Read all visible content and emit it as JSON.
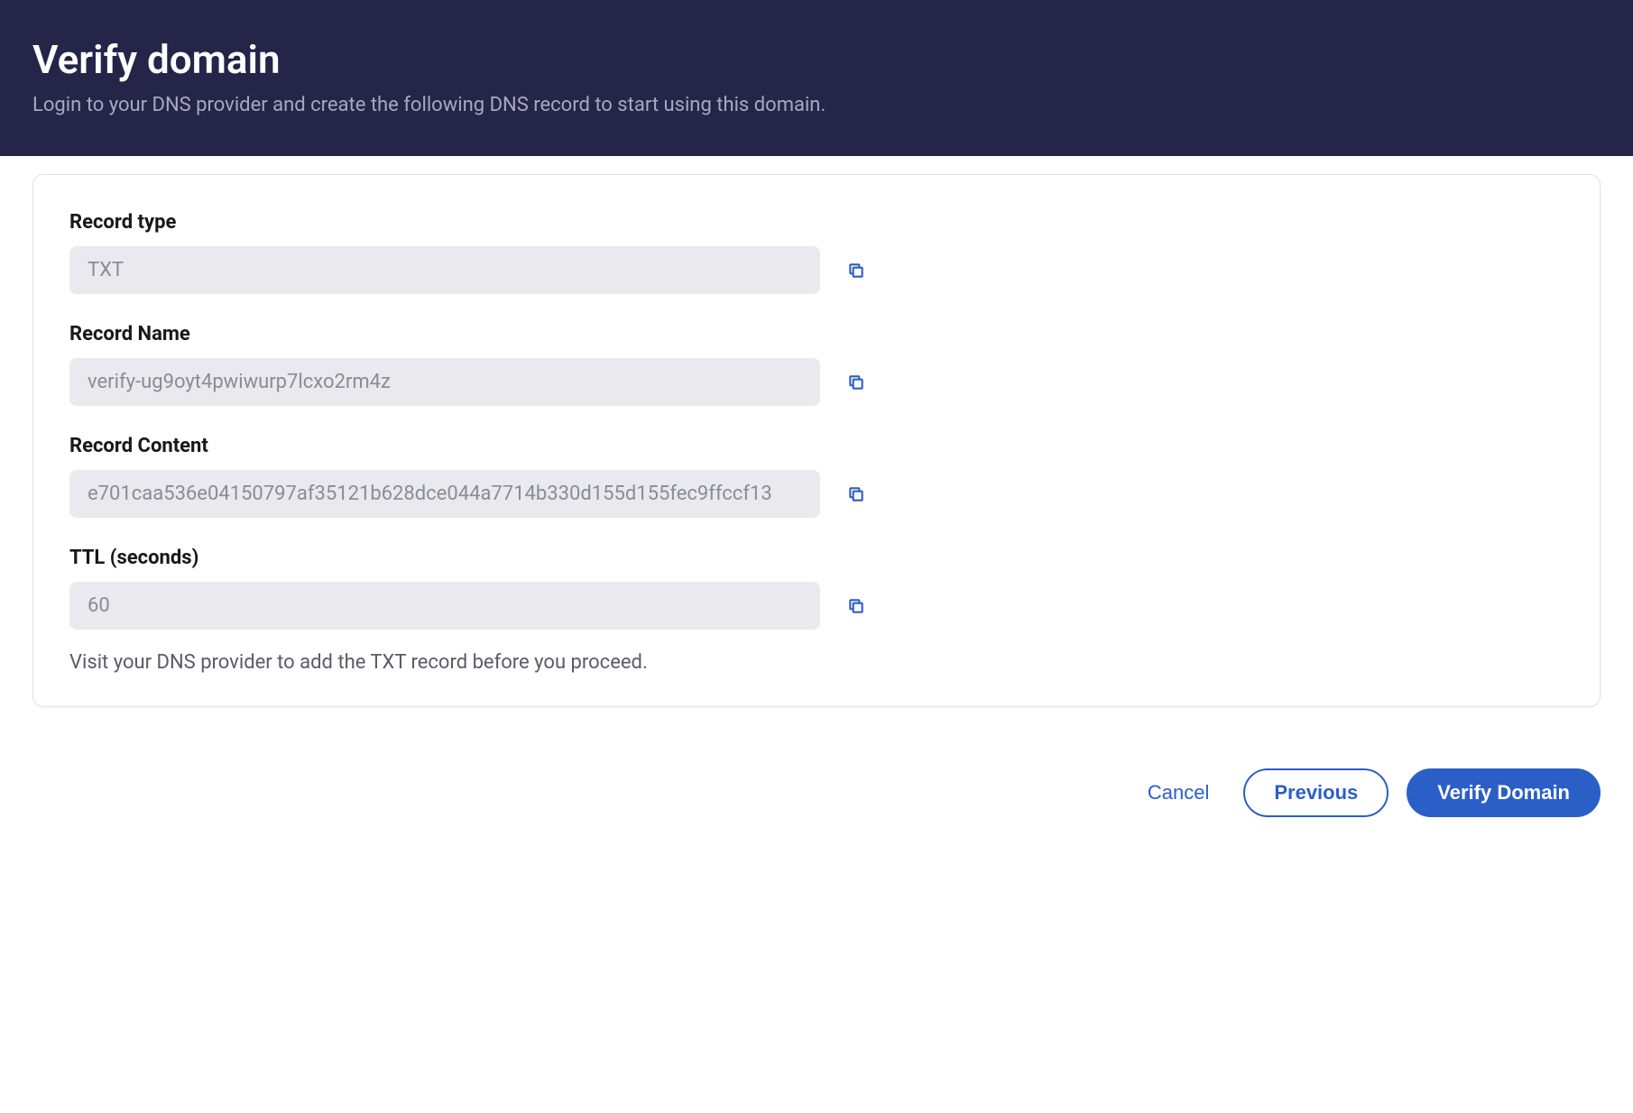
{
  "header": {
    "title": "Verify domain",
    "subtitle": "Login to your DNS provider and create the following DNS record to start using this domain."
  },
  "fields": {
    "record_type": {
      "label": "Record type",
      "value": "TXT"
    },
    "record_name": {
      "label": "Record Name",
      "value": "verify-ug9oyt4pwiwurp7lcxo2rm4z"
    },
    "record_content": {
      "label": "Record Content",
      "value": "e701caa536e04150797af35121b628dce044a7714b330d155d155fec9ffccf13"
    },
    "ttl": {
      "label": "TTL (seconds)",
      "value": "60"
    }
  },
  "helper_text": "Visit your DNS provider to add the TXT record before you proceed.",
  "footer": {
    "cancel_label": "Cancel",
    "previous_label": "Previous",
    "verify_label": "Verify Domain"
  }
}
